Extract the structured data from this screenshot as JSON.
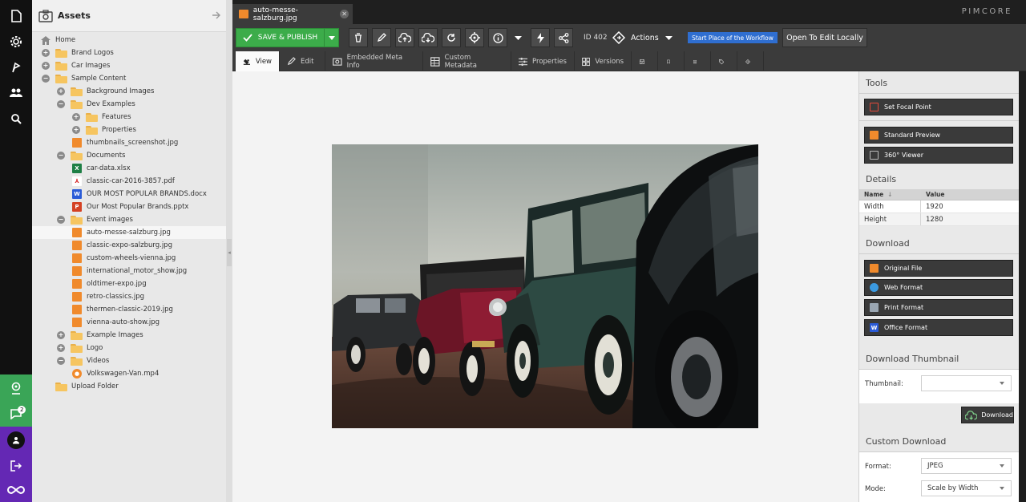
{
  "leftbar": {
    "notification_count": "2"
  },
  "tree": {
    "title": "Assets",
    "items": [
      {
        "label": "Home",
        "kind": "home",
        "indent": 0
      },
      {
        "label": "Brand Logos",
        "kind": "folder",
        "toggle": "+",
        "indent": 0
      },
      {
        "label": "Car Images",
        "kind": "folder",
        "toggle": "+",
        "indent": 0
      },
      {
        "label": "Sample Content",
        "kind": "folder",
        "toggle": "−",
        "indent": 0
      },
      {
        "label": "Background Images",
        "kind": "folder",
        "toggle": "+",
        "indent": 1
      },
      {
        "label": "Dev Examples",
        "kind": "folder",
        "toggle": "−",
        "indent": 1
      },
      {
        "label": "Features",
        "kind": "folder",
        "toggle": "+",
        "indent": 2
      },
      {
        "label": "Properties",
        "kind": "folder",
        "toggle": "+",
        "indent": 2
      },
      {
        "label": "thumbnails_screenshot.jpg",
        "kind": "image",
        "indent": 2
      },
      {
        "label": "Documents",
        "kind": "folder",
        "toggle": "−",
        "indent": 1
      },
      {
        "label": "car-data.xlsx",
        "kind": "xlsx",
        "indent": 2
      },
      {
        "label": "classic-car-2016-3857.pdf",
        "kind": "pdf",
        "indent": 2
      },
      {
        "label": "OUR MOST POPULAR BRANDS.docx",
        "kind": "docx",
        "indent": 2
      },
      {
        "label": "Our Most Popular Brands.pptx",
        "kind": "pptx",
        "indent": 2
      },
      {
        "label": "Event images",
        "kind": "folder",
        "toggle": "−",
        "indent": 1
      },
      {
        "label": "auto-messe-salzburg.jpg",
        "kind": "image",
        "indent": 2,
        "selected": true
      },
      {
        "label": "classic-expo-salzburg.jpg",
        "kind": "image",
        "indent": 2
      },
      {
        "label": "custom-wheels-vienna.jpg",
        "kind": "image",
        "indent": 2
      },
      {
        "label": "international_motor_show.jpg",
        "kind": "image",
        "indent": 2
      },
      {
        "label": "oldtimer-expo.jpg",
        "kind": "image",
        "indent": 2
      },
      {
        "label": "retro-classics.jpg",
        "kind": "image",
        "indent": 2
      },
      {
        "label": "thermen-classic-2019.jpg",
        "kind": "image",
        "indent": 2
      },
      {
        "label": "vienna-auto-show.jpg",
        "kind": "image",
        "indent": 2
      },
      {
        "label": "Example Images",
        "kind": "folder",
        "toggle": "+",
        "indent": 1
      },
      {
        "label": "Logo",
        "kind": "folder",
        "toggle": "+",
        "indent": 1
      },
      {
        "label": "Videos",
        "kind": "folder",
        "toggle": "−",
        "indent": 1
      },
      {
        "label": "Volkswagen-Van.mp4",
        "kind": "video",
        "indent": 2
      },
      {
        "label": "Upload Folder",
        "kind": "folder",
        "indent": 0
      }
    ]
  },
  "tab": {
    "label": "auto-messe-salzburg.jpg"
  },
  "brand": {
    "logo_text": "PIMCORE"
  },
  "toolbar": {
    "save_label": "SAVE & PUBLISH",
    "id_label": "ID 402",
    "actions_label": "Actions",
    "workflow_label": "Start Place of the Workflow",
    "open_local_label": "Open To Edit Locally"
  },
  "subtabs": {
    "view": "View",
    "edit": "Edit",
    "meta": "Embedded Meta Info",
    "custom_meta": "Custom Metadata",
    "properties": "Properties",
    "versions": "Versions"
  },
  "right": {
    "tools_title": "Tools",
    "focal_point": "Set Focal Point",
    "standard_preview": "Standard Preview",
    "viewer360": "360° Viewer",
    "details_title": "Details",
    "details_header": {
      "name": "Name",
      "value": "Value"
    },
    "details_rows": [
      {
        "name": "Width",
        "value": "1920"
      },
      {
        "name": "Height",
        "value": "1280"
      }
    ],
    "download_title": "Download",
    "original_file": "Original File",
    "web_format": "Web Format",
    "print_format": "Print Format",
    "office_format": "Office Format",
    "thumb_title": "Download Thumbnail",
    "thumb_label": "Thumbnail:",
    "thumb_value": "",
    "download_btn": "Download",
    "custom_title": "Custom Download",
    "format_label": "Format:",
    "format_value": "JPEG",
    "mode_label": "Mode:",
    "mode_value": "Scale by Width"
  },
  "colors": {
    "accent_green": "#3cac4a",
    "workflow_blue": "#2f6ed0",
    "leftbar_green": "#3aa557",
    "leftbar_purple": "#6428b4"
  }
}
